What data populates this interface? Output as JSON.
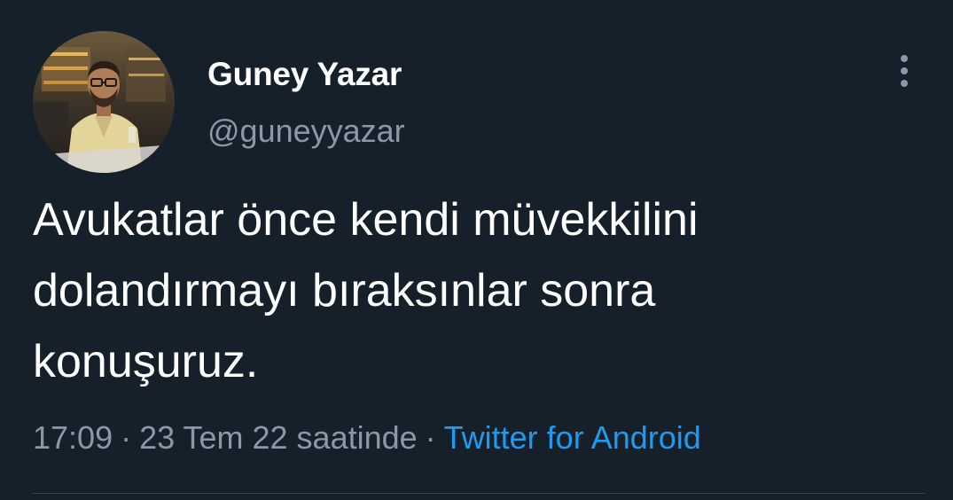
{
  "tweet": {
    "author": {
      "display_name": "Guney Yazar",
      "handle": "@guneyyazar"
    },
    "text": "Avukatlar önce kendi müvekkilini\ndolandırmayı bıraksınlar sonra\nkonuşuruz.",
    "time": "17:09",
    "separator": "·",
    "date": "23 Tem 22 saatinde",
    "source": "Twitter for Android"
  },
  "colors": {
    "background": "#15202b",
    "primary_text": "#ffffff",
    "secondary_text": "#8b98a5",
    "link": "#1d9bf0",
    "divider": "#38444d"
  },
  "icons": {
    "more_menu": "more-vertical-icon"
  }
}
